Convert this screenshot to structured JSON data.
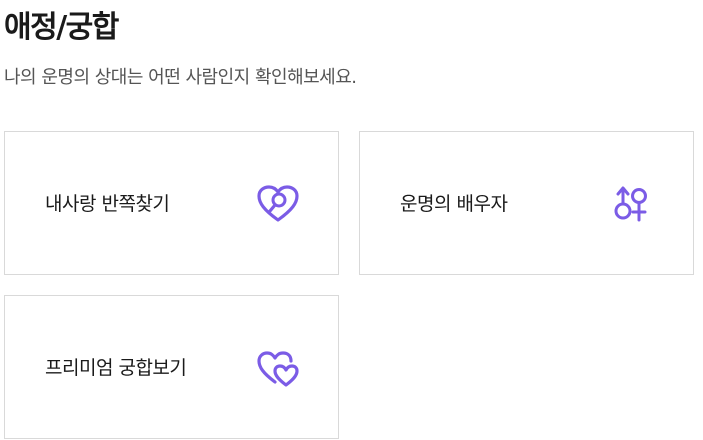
{
  "header": {
    "title": "애정/궁합",
    "subtitle": "나의 운명의 상대는 어떤 사람인지 확인해보세요."
  },
  "accent_color": "#7b5ce6",
  "cards": [
    {
      "label": "내사랑 반쪽찾기",
      "icon": "heart-search-icon"
    },
    {
      "label": "운명의 배우자",
      "icon": "male-female-icon"
    },
    {
      "label": "프리미엄 궁합보기",
      "icon": "double-heart-icon"
    }
  ]
}
